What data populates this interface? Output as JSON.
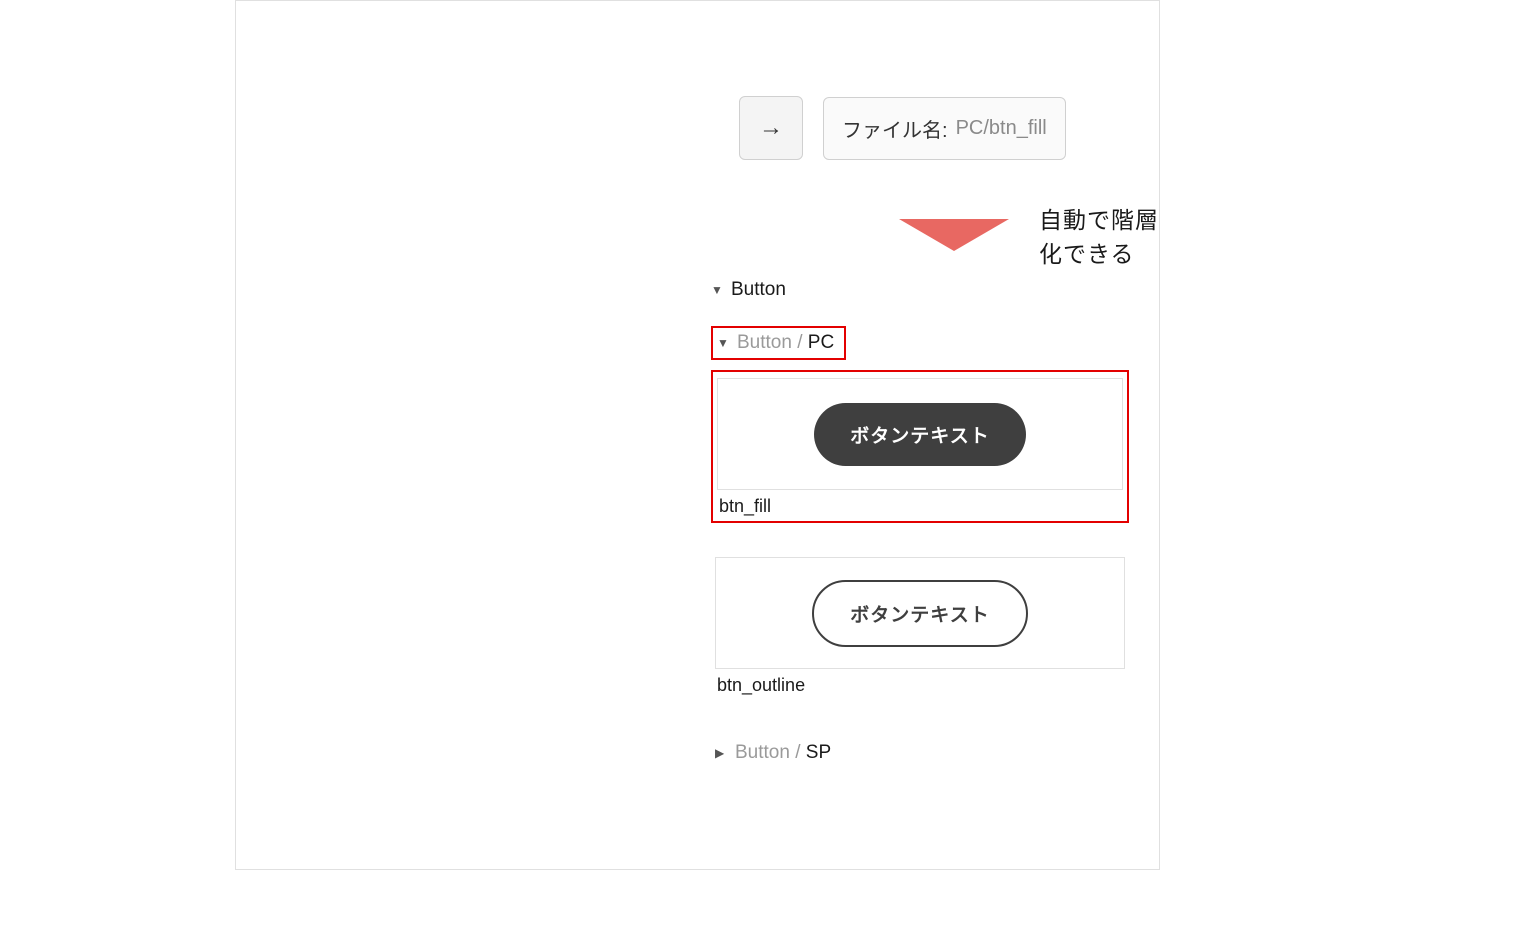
{
  "filename": {
    "label": "ファイル名:",
    "value": "PC/btn_fill"
  },
  "annotation": "自動で階層化できる",
  "tree": {
    "root": "Button",
    "pc_group": {
      "prefix": "Button / ",
      "name": "PC"
    },
    "sp_group": {
      "prefix": "Button / ",
      "name": "SP"
    }
  },
  "components": {
    "btn_fill": {
      "text": "ボタンテキスト",
      "label": "btn_fill"
    },
    "btn_outline": {
      "text": "ボタンテキスト",
      "label": "btn_outline"
    }
  }
}
